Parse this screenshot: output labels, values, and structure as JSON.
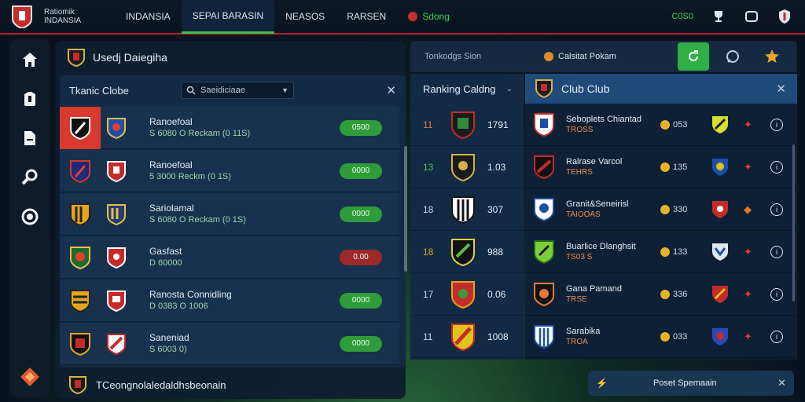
{
  "brand": {
    "line1": "Ratiomik",
    "line2": "INDANSIA"
  },
  "topnav": {
    "tabs": [
      {
        "label": "INDANSIA"
      },
      {
        "label": "SEPAI BARASIN"
      },
      {
        "label": "NEASOS"
      },
      {
        "label": "RARSEN"
      },
      {
        "label": "Sdong"
      }
    ],
    "coins": "C0S0"
  },
  "left_panel": {
    "title": "Usedj Daiegiha",
    "sub_title": "Tkanic Clobe",
    "search_placeholder": "Saeidiciaae",
    "teams": [
      {
        "name": "Ranoefoal",
        "sub": "S 6080 O Reckam (0 11S)",
        "pill": "0500",
        "pill_color": "#2f9c3a"
      },
      {
        "name": "Ranoefoal",
        "sub": "5 3000 Reckm (0 1S)",
        "pill": "0000",
        "pill_color": "#2f9c3a"
      },
      {
        "name": "Sariolamal",
        "sub": "S 6080 O Reckam (0 1S)",
        "pill": "0000",
        "pill_color": "#2f9c3a"
      },
      {
        "name": "Gasfast",
        "sub": "D 60000",
        "pill": "0.00",
        "pill_color": "#9c2a2a"
      },
      {
        "name": "Ranosta Connidling",
        "sub": "D 0383 O 1006",
        "pill": "0000",
        "pill_color": "#2f9c3a"
      },
      {
        "name": "Saneniad",
        "sub": "S 6003 0)",
        "pill": "0000",
        "pill_color": "#2f9c3a"
      }
    ],
    "footer": "TCeongnolaledaldhsbeonain"
  },
  "right_panel": {
    "tab1": "Tonkodgs Sion",
    "tab2": "Calsitat Pokam",
    "rank_title": "Ranking Caldng",
    "club_title": "Club Club",
    "ranks": [
      {
        "pos": "11",
        "val": "1791"
      },
      {
        "pos": "13",
        "val": "1.03"
      },
      {
        "pos": "18",
        "val": "307"
      },
      {
        "pos": "18",
        "val": "988"
      },
      {
        "pos": "17",
        "val": "0.06"
      },
      {
        "pos": "11",
        "val": "1008"
      }
    ],
    "clubs": [
      {
        "name": "Seboplets Chiantad",
        "sub": "TROSS",
        "pts": "053"
      },
      {
        "name": "Ralrase Varcol",
        "sub": "TEHRS",
        "pts": "135"
      },
      {
        "name": "Granit&Seneirisl",
        "sub": "TAIOOAS",
        "pts": "330"
      },
      {
        "name": "Buarlice Dlanghsit",
        "sub": "TS03 S",
        "pts": "133"
      },
      {
        "name": "Gana Pamand",
        "sub": "TRSE",
        "pts": "336"
      },
      {
        "name": "Sarabika",
        "sub": "TROA",
        "pts": "033"
      }
    ],
    "footer": "Poset Spemaain"
  }
}
